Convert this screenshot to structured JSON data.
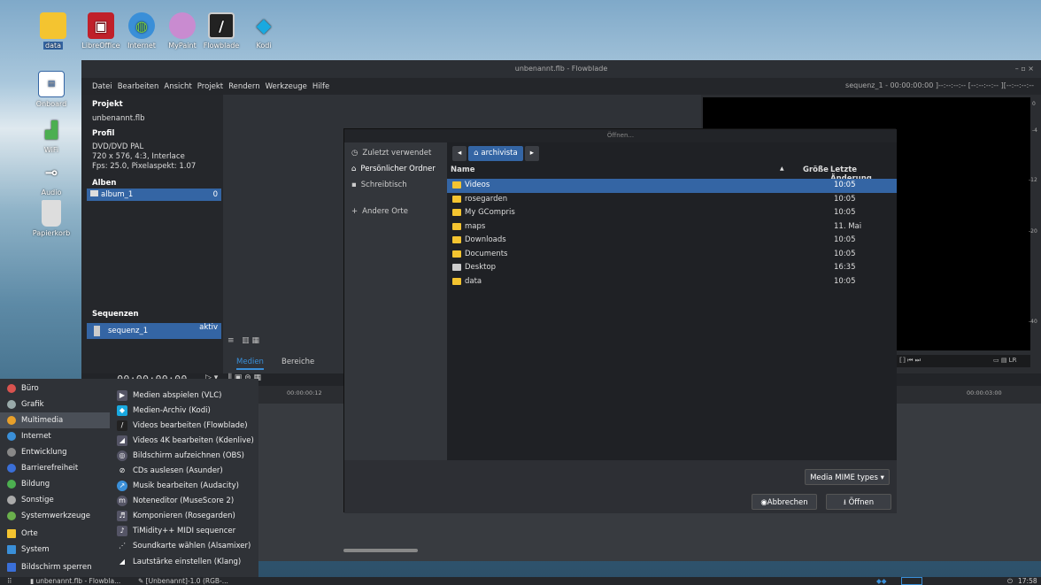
{
  "desktop_icons_top": [
    {
      "label": "data",
      "icon": "folder-icon",
      "color": "#f4c430"
    },
    {
      "label": "LibreOffice",
      "icon": "libreoffice-icon",
      "color": "#c0202a"
    },
    {
      "label": "Internet",
      "icon": "globe-icon",
      "color": "#3a8fd8"
    },
    {
      "label": "MyPaint",
      "icon": "palette-icon",
      "color": "#c98bd0"
    },
    {
      "label": "Flowblade",
      "icon": "flowblade-icon",
      "color": "#333"
    },
    {
      "label": "Kodi",
      "icon": "kodi-icon",
      "color": "#19a9e0"
    }
  ],
  "desktop_icons_left": [
    {
      "label": "Onboard",
      "icon": "keyboard-icon"
    },
    {
      "label": "WiFi",
      "icon": "wifi-icon"
    },
    {
      "label": "Audio",
      "icon": "mixer-icon"
    },
    {
      "label": "Papierkorb",
      "icon": "trash-icon"
    }
  ],
  "window": {
    "title": "unbenannt.flb - Flowblade",
    "controls": "–  ▫  ×",
    "menu": [
      "Datei",
      "Bearbeiten",
      "Ansicht",
      "Projekt",
      "Rendern",
      "Werkzeuge",
      "Hilfe"
    ],
    "seq_info": "sequenz_1 - 00:00:00:00   ]--:--:--:--   [--:--:--:--   ][--:--:--:--",
    "project_label": "Projekt",
    "project_name": "unbenannt.flb",
    "profile_label": "Profil",
    "profile_name": "DVD/DVD PAL",
    "profile_res": "720 x 576, 4:3, Interlace",
    "profile_fps": "Fps: 25.0, Pixelaspekt: 1.07",
    "albums_label": "Alben",
    "album": "album_1",
    "album_count": "0",
    "sequences_label": "Sequenzen",
    "sequence": "sequenz_1",
    "sequence_status": "aktiv",
    "tab_media": "Medien",
    "tab_ranges": "Bereiche",
    "timecode": "00:00:00:00",
    "ruler_1": "00:00:00:12",
    "ruler_2": "00:00:03:00",
    "meter_ticks": [
      "0",
      "-4",
      "-12",
      "-20",
      "-40"
    ]
  },
  "dialog": {
    "title": "Öffnen...",
    "sidebar": [
      {
        "label": "Zuletzt verwendet",
        "icon": "clock-icon"
      },
      {
        "label": "Persönlicher Ordner",
        "icon": "home-icon"
      },
      {
        "label": "Schreibtisch",
        "icon": "desktop-icon"
      },
      {
        "label": "Andere Orte",
        "icon": "plus-icon"
      }
    ],
    "crumb": "archivista",
    "col_name": "Name",
    "col_size": "Größe",
    "col_date": "Letzte Änderung",
    "files": [
      {
        "name": "Videos",
        "date": "10:05"
      },
      {
        "name": "rosegarden",
        "date": "10:05"
      },
      {
        "name": "My GCompris",
        "date": "10:05"
      },
      {
        "name": "maps",
        "date": "11. Mai"
      },
      {
        "name": "Downloads",
        "date": "10:05"
      },
      {
        "name": "Documents",
        "date": "10:05"
      },
      {
        "name": "Desktop",
        "date": "16:35"
      },
      {
        "name": "data",
        "date": "10:05"
      }
    ],
    "filter": "Media MIME types ▾",
    "cancel": "Abbrechen",
    "open": "Öffnen"
  },
  "menu": {
    "categories": [
      {
        "label": "Büro",
        "color": "#d9534f"
      },
      {
        "label": "Grafik",
        "color": "#9aa"
      },
      {
        "label": "Multimedia",
        "color": "#e8a02a"
      },
      {
        "label": "Internet",
        "color": "#3a8fd8"
      },
      {
        "label": "Entwicklung",
        "color": "#888"
      },
      {
        "label": "Barrierefreiheit",
        "color": "#3a6fd8"
      },
      {
        "label": "Bildung",
        "color": "#4caf50"
      },
      {
        "label": "Sonstige",
        "color": "#aaa"
      },
      {
        "label": "Systemwerkzeuge",
        "color": "#6ab04c"
      },
      {
        "label": "Orte",
        "color": "#f4c430"
      },
      {
        "label": "System",
        "color": "#3a8fd8"
      },
      {
        "label": "Bildschirm sperren",
        "color": "#3a6fd8"
      }
    ],
    "apps": [
      "Medien abspielen (VLC)",
      "Medien-Archiv (Kodi)",
      "Videos bearbeiten (Flowblade)",
      "Videos 4K bearbeiten (Kdenlive)",
      "Bildschirm aufzeichnen (OBS)",
      "CDs auslesen (Asunder)",
      "Musik bearbeiten (Audacity)",
      "Noteneditor (MuseScore 2)",
      "Komponieren (Rosegarden)",
      "TiMidity++ MIDI sequencer",
      "Soundkarte wählen (Alsamixer)",
      "Lautstärke einstellen (Klang)"
    ]
  },
  "taskbar": {
    "task1": "unbenannt.flb - Flowbla...",
    "task2": "[Unbenannt]-1.0 (RGB-...",
    "clock": "17:58"
  }
}
